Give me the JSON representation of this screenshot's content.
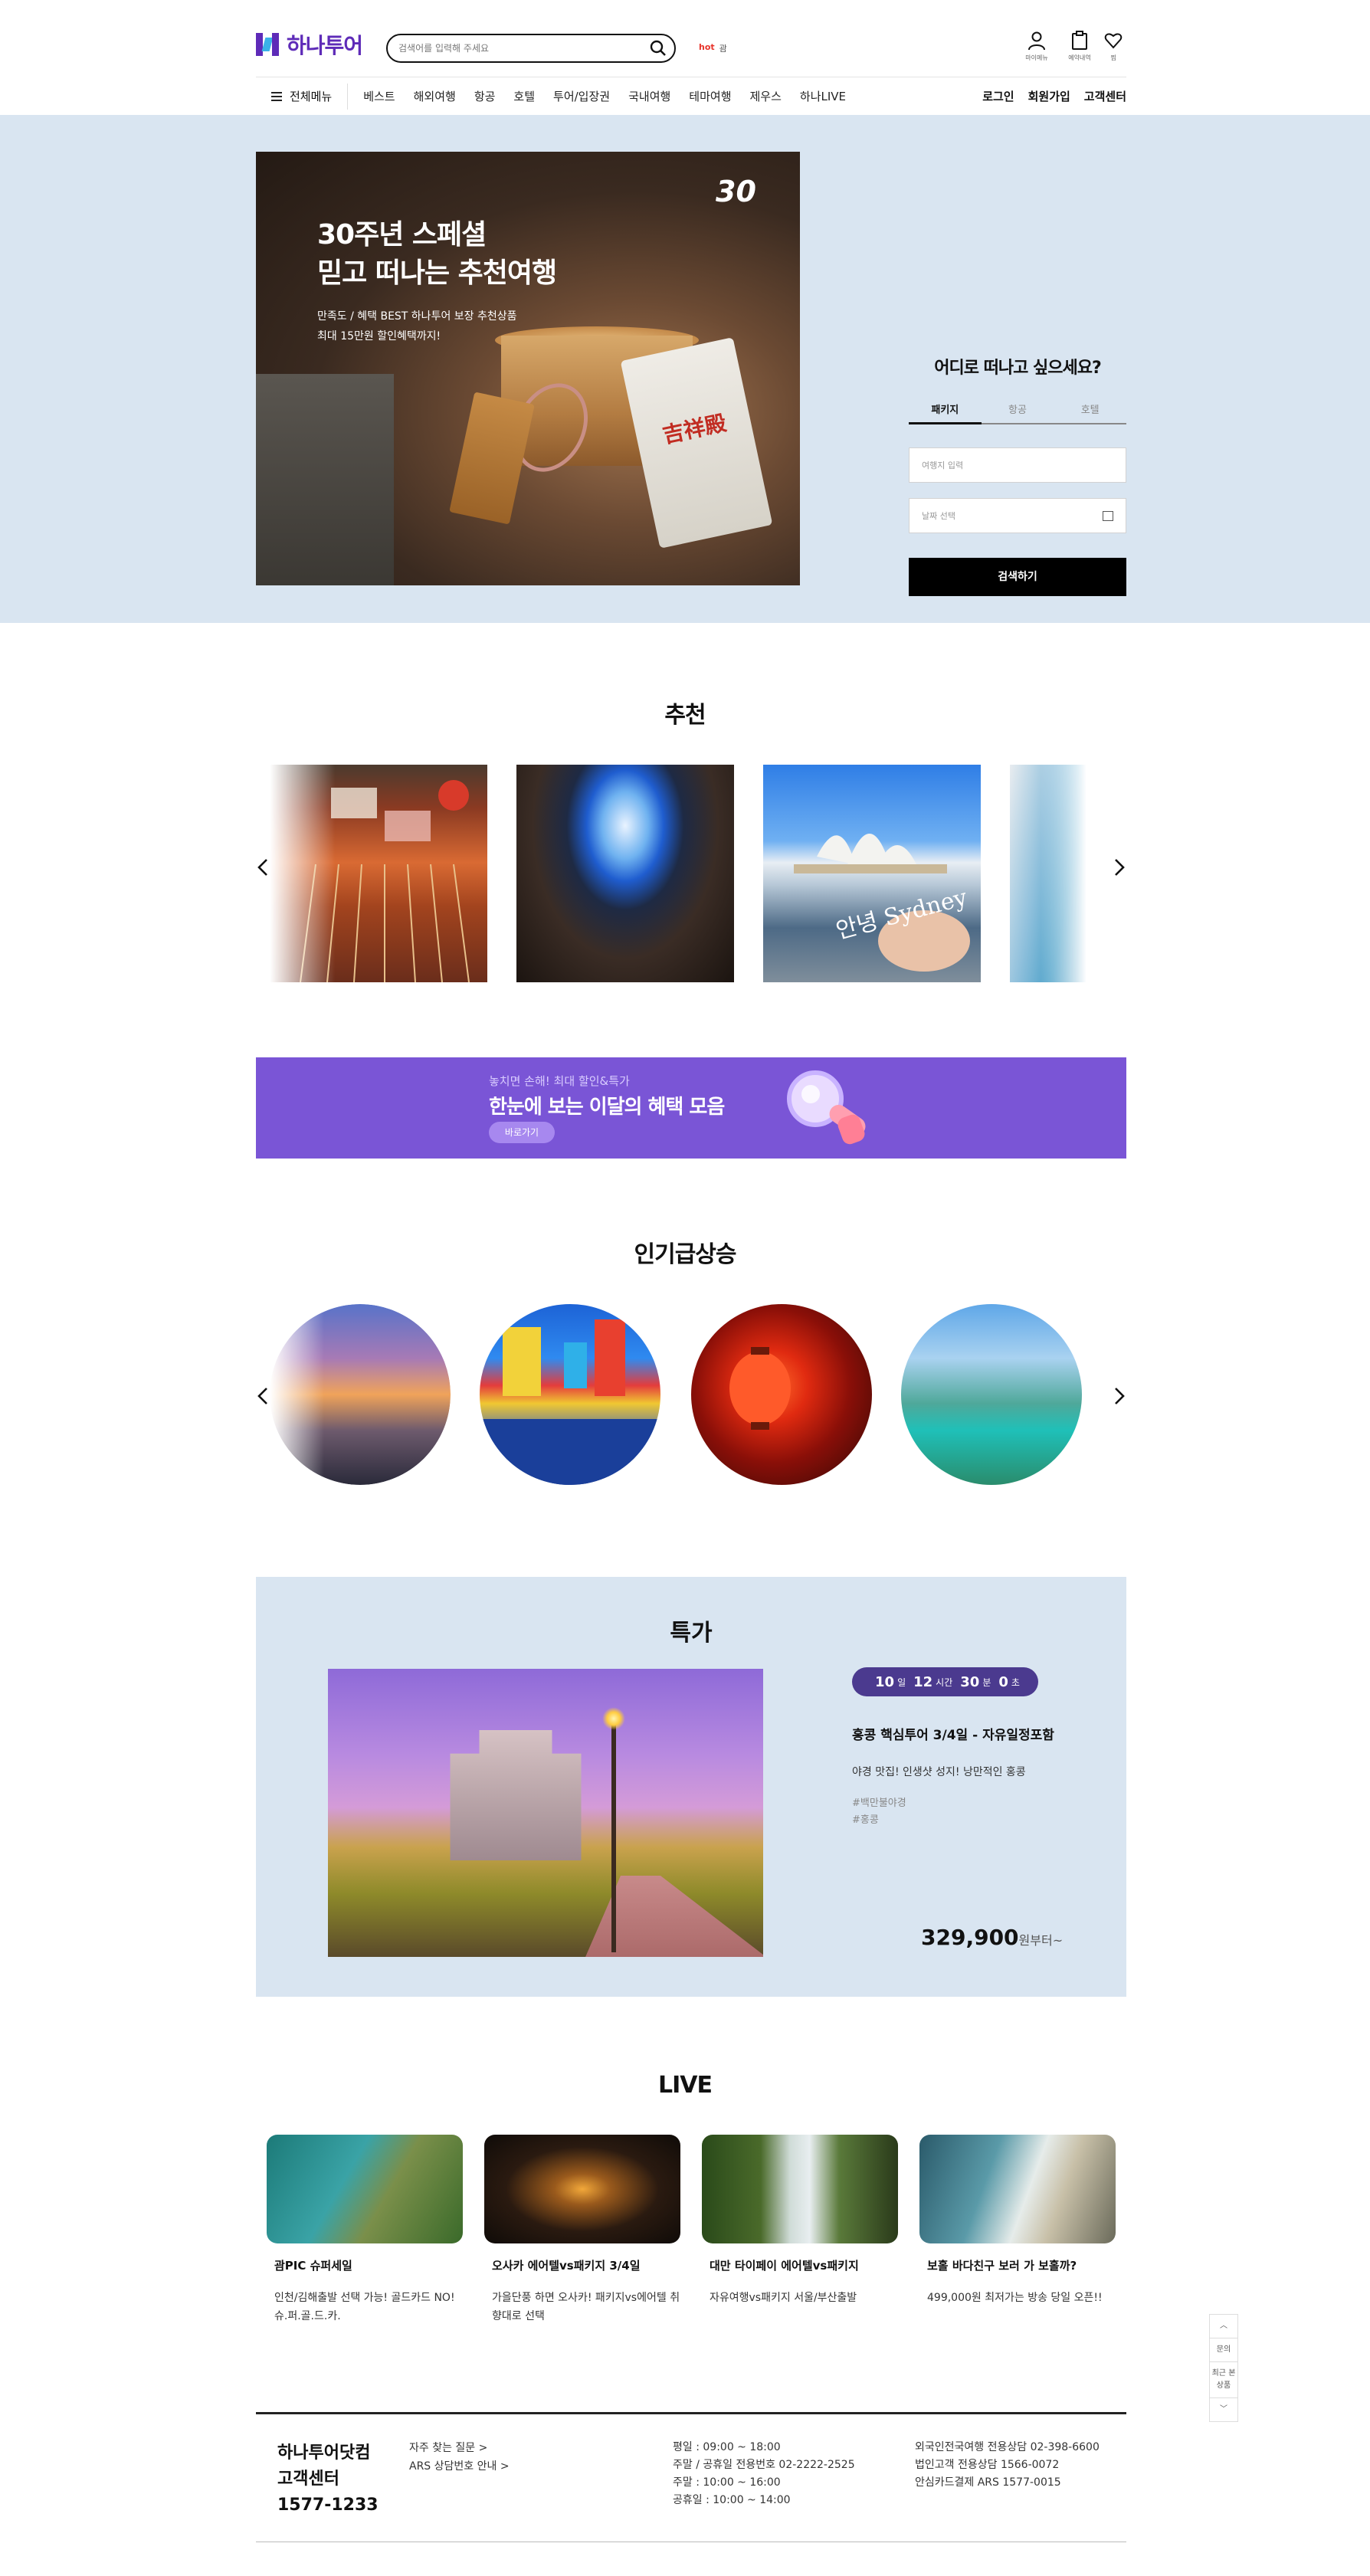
{
  "header": {
    "logo_text": "하나투어",
    "search_placeholder": "검색어를 입력해 주세요",
    "hot_label": "hot",
    "hot_word": "괌",
    "utils": [
      {
        "label": "마이메뉴",
        "icon": "user-icon"
      },
      {
        "label": "예약내역",
        "icon": "clipboard-icon"
      },
      {
        "label": "찜",
        "icon": "heart-icon"
      }
    ]
  },
  "gnb": {
    "all_menu": "전체메뉴",
    "items": [
      "베스트",
      "해외여행",
      "항공",
      "호텔",
      "투어/입장권",
      "국내여행",
      "테마여행",
      "제우스",
      "하나LIVE"
    ],
    "right": [
      "로그인",
      "회원가입",
      "고객센터"
    ]
  },
  "hero": {
    "title_line1": "30주년 스페셜",
    "title_line2": "믿고 떠나는 추천여행",
    "sub_line1": "만족도 / 혜택 BEST 하나투어 보장 추천상품",
    "sub_line2": "최대 15만원 할인혜택까지!",
    "badge_number": "30",
    "image_text": "吉祥殿"
  },
  "finder": {
    "title": "어디로 떠나고 싶으세요?",
    "tabs": [
      "패키지",
      "항공",
      "호텔"
    ],
    "active_tab": "패키지",
    "destination_placeholder": "여행지 입력",
    "date_placeholder": "날짜 선택",
    "search_label": "검색하기"
  },
  "recommend": {
    "title": "추천",
    "sydney_text": "안녕 Sydney"
  },
  "banner": {
    "small": "놓치면 손해! 최대 할인&특가",
    "big": "한눈에 보는 이달의 혜택 모음",
    "button": "바로가기"
  },
  "popular": {
    "title": "인기급상승"
  },
  "special": {
    "title": "특가",
    "timer": {
      "days": "10",
      "days_unit": "일",
      "hours": "12",
      "hours_unit": "시간",
      "minutes": "30",
      "minutes_unit": "분",
      "seconds": "0",
      "seconds_unit": "초"
    },
    "name": "홍콩 핵심투어 3/4일 - 자유일정포함",
    "desc": "야경 맛집! 인생샷 성지! 낭만적인 홍콩",
    "tags": [
      "#백만불야경",
      "#홍콩"
    ],
    "price": "329,900",
    "price_unit": "원부터~"
  },
  "live": {
    "title": "LIVE",
    "items": [
      {
        "name": "괌PIC 슈퍼세일",
        "desc": "인천/김해출발 선택 가능! 골드카드 NO! 슈.퍼.골.드.카."
      },
      {
        "name": "오사카 에어텔vs패키지 3/4일",
        "desc": "가을단풍 하면 오사카! 패키지vs에어텔 취향대로 선택"
      },
      {
        "name": "대만 타이페이 에어텔vs패키지",
        "desc": "자유여행vs패키지 서울/부산출발"
      },
      {
        "name": "보홀 바다친구 보러 가 보홀까?",
        "desc": "499,000원 최저가는 방송 당일 오픈!!"
      }
    ]
  },
  "side_tool": {
    "up": "︿",
    "inquiry": "문의",
    "recent": "최근 본 상품",
    "down": "﹀"
  },
  "footer": {
    "cs_line1": "하나투어닷컴",
    "cs_line2": "고객센터",
    "cs_phone": "1577-1233",
    "links": [
      "자주 찾는 질문 >",
      "ARS 상담번호 안내 >"
    ],
    "hours": [
      "평일 : 09:00 ~ 18:00",
      "주말 / 공휴일 전용번호 02-2222-2525",
      "주말 : 10:00 ~ 16:00",
      "공휴일 : 10:00 ~ 14:00"
    ],
    "phones": [
      "외국인전국여행 전용상담 02-398-6600",
      "법인고객 전용상담 1566-0072",
      "안심카드결제 ARS 1577-0015"
    ]
  }
}
